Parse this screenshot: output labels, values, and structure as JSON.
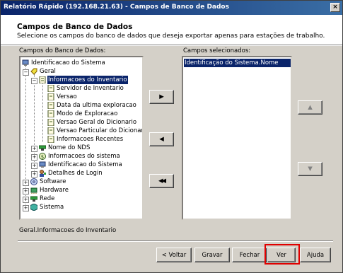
{
  "window": {
    "title": "Relatório Rápido (192.168.21.63) - Campos de Banco de Dados",
    "close_glyph": "×"
  },
  "header": {
    "heading": "Campos de Banco de Dados",
    "subtitle": "Selecione os campos do banco de dados que deseja exportar apenas para estações de trabalho."
  },
  "left_panel": {
    "label": "Campos do Banco de Dados:"
  },
  "right_panel": {
    "label": "Campos selecionados:"
  },
  "tree": {
    "root": {
      "label": "Identificacao do Sistema",
      "icon": "computer-icon"
    },
    "geral": {
      "label": "Geral",
      "icon": "tag-icon"
    },
    "inventario": {
      "label": "Informacoes do Inventario",
      "icon": "document-icon",
      "selected": true
    },
    "inventario_children": [
      {
        "label": "Servidor de Inventario"
      },
      {
        "label": "Versao"
      },
      {
        "label": "Data da ultima exploracao"
      },
      {
        "label": "Modo de Exploracao"
      },
      {
        "label": "Versao Geral do Dicionario"
      },
      {
        "label": "Versao Particular do Dicionario"
      },
      {
        "label": "Informacoes Recentes"
      }
    ],
    "geral_siblings": [
      {
        "label": "Nome do NDS",
        "icon": "network-icon"
      },
      {
        "label": "Informacoes do sistema",
        "icon": "dollar-icon"
      },
      {
        "label": "Identificacao do Sistema",
        "icon": "computer-icon"
      },
      {
        "label": "Detalhes de Login",
        "icon": "login-icon"
      }
    ],
    "top_level": [
      {
        "label": "Software",
        "icon": "disc-icon"
      },
      {
        "label": "Hardware",
        "icon": "hardware-icon"
      },
      {
        "label": "Rede",
        "icon": "network-icon"
      },
      {
        "label": "Sistema",
        "icon": "cube-icon"
      }
    ],
    "expand_glyph": "+",
    "collapse_glyph": "−"
  },
  "selected_fields": [
    "Identificação do Sistema.Nome"
  ],
  "transfer_buttons": {
    "add": "▶",
    "remove": "◀",
    "remove_all": "◀◀"
  },
  "order_buttons": {
    "up": "▲",
    "down": "▼"
  },
  "status_path": "Geral.Informacoes do Inventario",
  "footer": {
    "back": "< Voltar",
    "save": "Gravar",
    "close": "Fechar",
    "view": "Ver",
    "help": "Ajuda"
  },
  "colors": {
    "selection": "#0a246a",
    "highlight_box": "#e00000",
    "title_start": "#0a246a",
    "title_end": "#3a6ea5"
  }
}
